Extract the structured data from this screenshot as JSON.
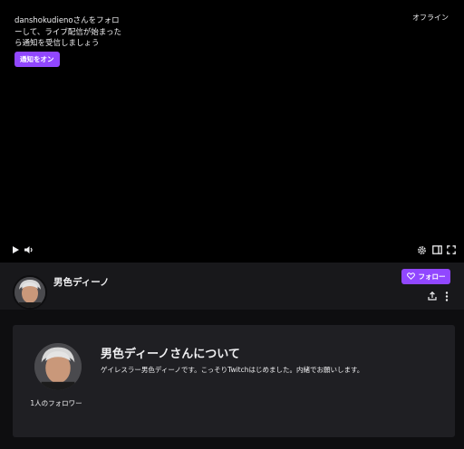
{
  "player": {
    "offline_message": "danshokudienoさんをフォローして、ライブ配信が始まったら通知を受信しましょう",
    "notify_button": "通知をオン",
    "status": "オフライン"
  },
  "channel": {
    "name": "男色ディーノ",
    "follow_button": "フォロー"
  },
  "about": {
    "title": "男色ディーノさんについて",
    "description": "ゲイレスラー男色ディーノです。こっそりTwitchはじめました。内緒でお願いします。",
    "followers": "1人のフォロワー"
  },
  "colors": {
    "accent": "#9147ff",
    "background": "#0e0e10",
    "panel": "#1f1f23",
    "player_bg": "#000000"
  },
  "icons": {
    "play": "play-icon",
    "volume": "volume-icon",
    "settings": "gear-icon",
    "theatre": "theatre-mode-icon",
    "fullscreen": "fullscreen-icon",
    "heart": "heart-icon",
    "share": "share-icon",
    "more": "more-vertical-icon"
  }
}
